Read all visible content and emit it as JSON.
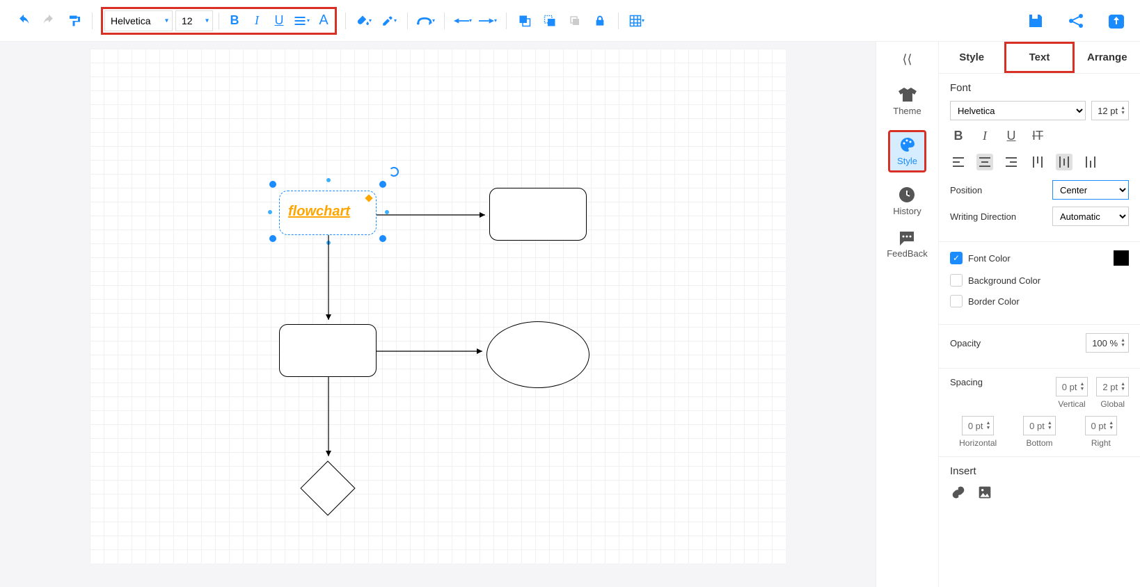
{
  "toolbar": {
    "font": "Helvetica",
    "size": "12"
  },
  "canvas": {
    "selected_label": "flowchart"
  },
  "sidenav": {
    "theme": "Theme",
    "style": "Style",
    "history": "History",
    "feedback": "FeedBack"
  },
  "panel": {
    "tabs": {
      "style": "Style",
      "text": "Text",
      "arrange": "Arrange"
    },
    "font_header": "Font",
    "font_family": "Helvetica",
    "font_size": "12 pt",
    "position_label": "Position",
    "position_value": "Center",
    "writing_dir_label": "Writing Direction",
    "writing_dir_value": "Automatic",
    "font_color_label": "Font Color",
    "bg_color_label": "Background Color",
    "border_color_label": "Border Color",
    "opacity_label": "Opacity",
    "opacity_value": "100 %",
    "spacing_label": "Spacing",
    "spacing": {
      "vertical": "0 pt",
      "vertical_label": "Vertical",
      "global": "2 pt",
      "global_label": "Global",
      "horizontal": "0 pt",
      "horizontal_label": "Horizontal",
      "bottom": "0 pt",
      "bottom_label": "Bottom",
      "right": "0 pt",
      "right_label": "Right"
    },
    "insert_label": "Insert"
  }
}
